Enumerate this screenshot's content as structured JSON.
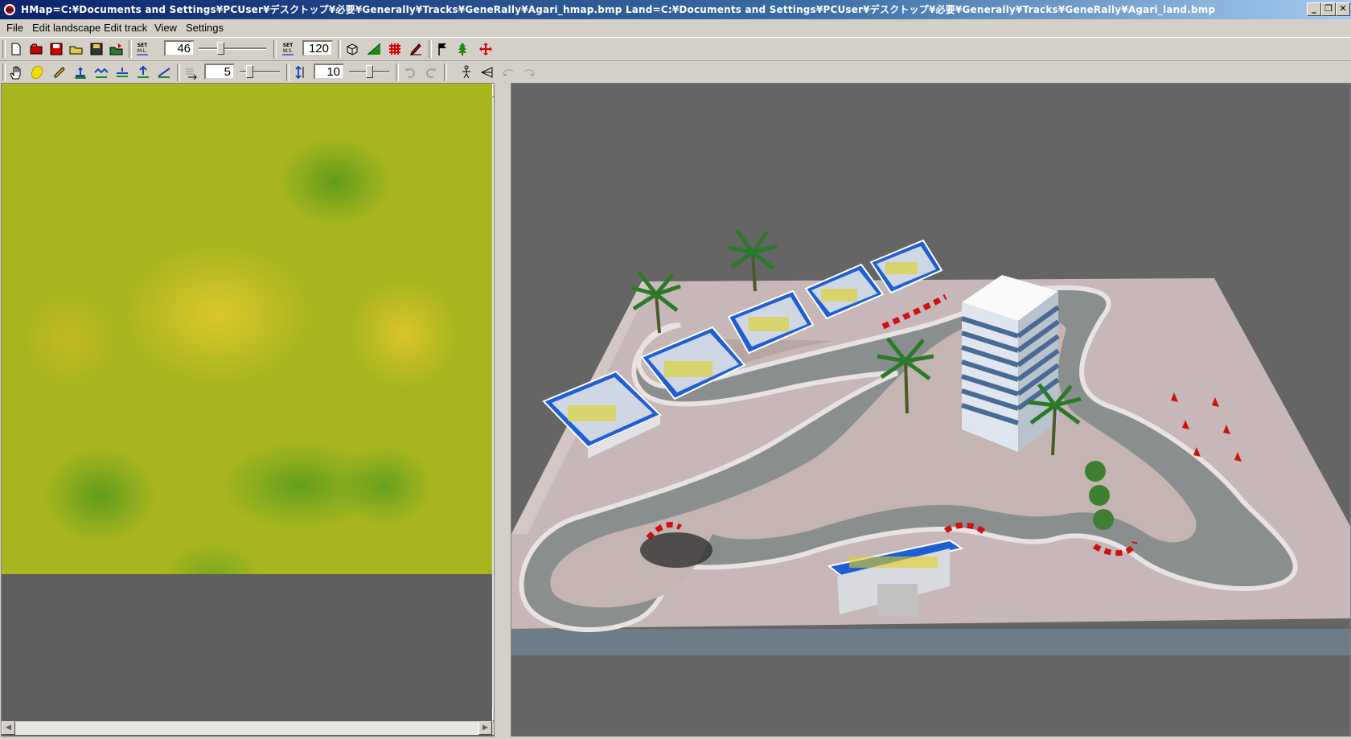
{
  "window": {
    "title": "HMap=C:¥Documents and Settings¥PCUser¥デスクトップ¥必要¥Generally¥Tracks¥GeneRally¥Agari_hmap.bmp     Land=C:¥Documents and Settings¥PCUser¥デスクトップ¥必要¥Generally¥Tracks¥GeneRally¥Agari_land.bmp",
    "minimize": "_",
    "restore": "❐",
    "close": "✕"
  },
  "menu": {
    "file": "File",
    "edit_landscape": "Edit landscape",
    "edit_track": "Edit track",
    "view": "View",
    "settings": "Settings"
  },
  "toolbar1": {
    "set_ml_value": "46",
    "set_ml_label": "SET M.L.",
    "set_ws_value": "120",
    "set_ws_label": "SET W.S.",
    "set_ml_slider_level": 0.3,
    "set_ws_slider_level": 0.5
  },
  "toolbar2": {
    "brush_size_value": "5",
    "brush_height_value": "10",
    "brush_size_slider_level": 0.2,
    "brush_height_slider_level": 0.5
  },
  "colors": {
    "titlebar": "#0a246a",
    "heightmap_green": "#5f9d1b",
    "heightmap_yellow": "#d9c72b",
    "track_asphalt": "#8a8d8c",
    "terrain": "#c4b2b2"
  },
  "icons": {
    "app": "generally-app-icon",
    "tools_row1": [
      "new-icon",
      "open-icon",
      "save-icon",
      "open-folder-icon",
      "save-as-icon",
      "export-icon",
      "set-ml-icon",
      "set-ws-icon",
      "3d-object-icon",
      "terrain-view-icon",
      "grid-icon",
      "pen-icon",
      "flag-icon",
      "tree-icon",
      "move-icon"
    ],
    "tools_row2": [
      "hand-icon",
      "smooth-brush-icon",
      "pencil-icon",
      "raise-icon",
      "lower-icon",
      "flatten-icon",
      "level-icon",
      "slope-icon",
      "brush-size-icon",
      "height-icon",
      "undo-icon",
      "redo-icon",
      "person-icon",
      "camera-icon",
      "rotate-left-icon",
      "rotate-right-icon"
    ]
  }
}
